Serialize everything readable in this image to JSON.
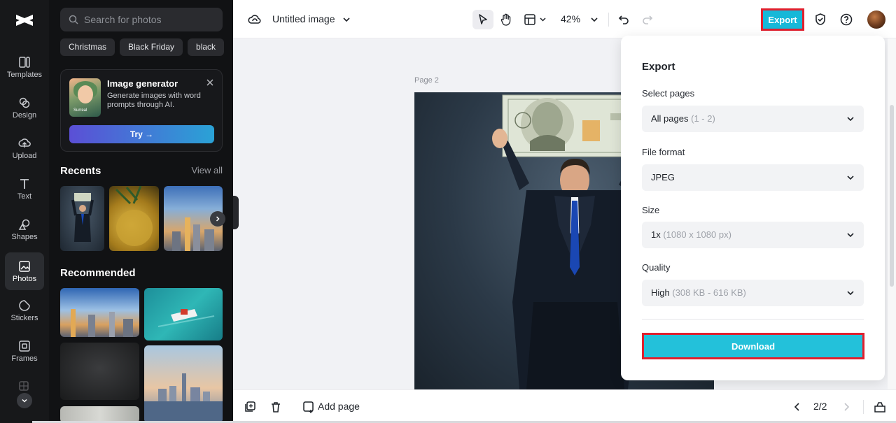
{
  "rail": {
    "items": [
      {
        "label": "Templates",
        "icon": "templates-icon"
      },
      {
        "label": "Design",
        "icon": "design-icon"
      },
      {
        "label": "Upload",
        "icon": "upload-icon"
      },
      {
        "label": "Text",
        "icon": "text-icon"
      },
      {
        "label": "Shapes",
        "icon": "shapes-icon"
      },
      {
        "label": "Photos",
        "icon": "photos-icon",
        "active": true
      },
      {
        "label": "Stickers",
        "icon": "stickers-icon"
      },
      {
        "label": "Frames",
        "icon": "frames-icon"
      }
    ]
  },
  "panel": {
    "search_placeholder": "Search for photos",
    "chips": [
      "Christmas",
      "Black Friday",
      "black"
    ],
    "generator": {
      "title": "Image generator",
      "description": "Generate images with word prompts through AI.",
      "thumb_tag": "Surreal",
      "try_label": "Try →"
    },
    "recents_title": "Recents",
    "view_all_label": "View all",
    "recommended_title": "Recommended"
  },
  "topbar": {
    "doc_title": "Untitled image",
    "zoom": "42%",
    "export_label": "Export"
  },
  "canvas": {
    "page_label": "Page 2"
  },
  "export_panel": {
    "title": "Export",
    "select_pages_label": "Select pages",
    "select_pages_value": "All pages",
    "select_pages_hint": "(1 - 2)",
    "file_format_label": "File format",
    "file_format_value": "JPEG",
    "size_label": "Size",
    "size_value": "1x",
    "size_hint": "(1080 x 1080 px)",
    "quality_label": "Quality",
    "quality_value": "High",
    "quality_hint": "(308 KB - 616 KB)",
    "download_label": "Download"
  },
  "bottombar": {
    "add_page_label": "Add page",
    "page_indicator": "2/2"
  },
  "colors": {
    "accent": "#16b8d8",
    "highlight_border": "#e0202e",
    "sidebar_bg": "#111214"
  }
}
